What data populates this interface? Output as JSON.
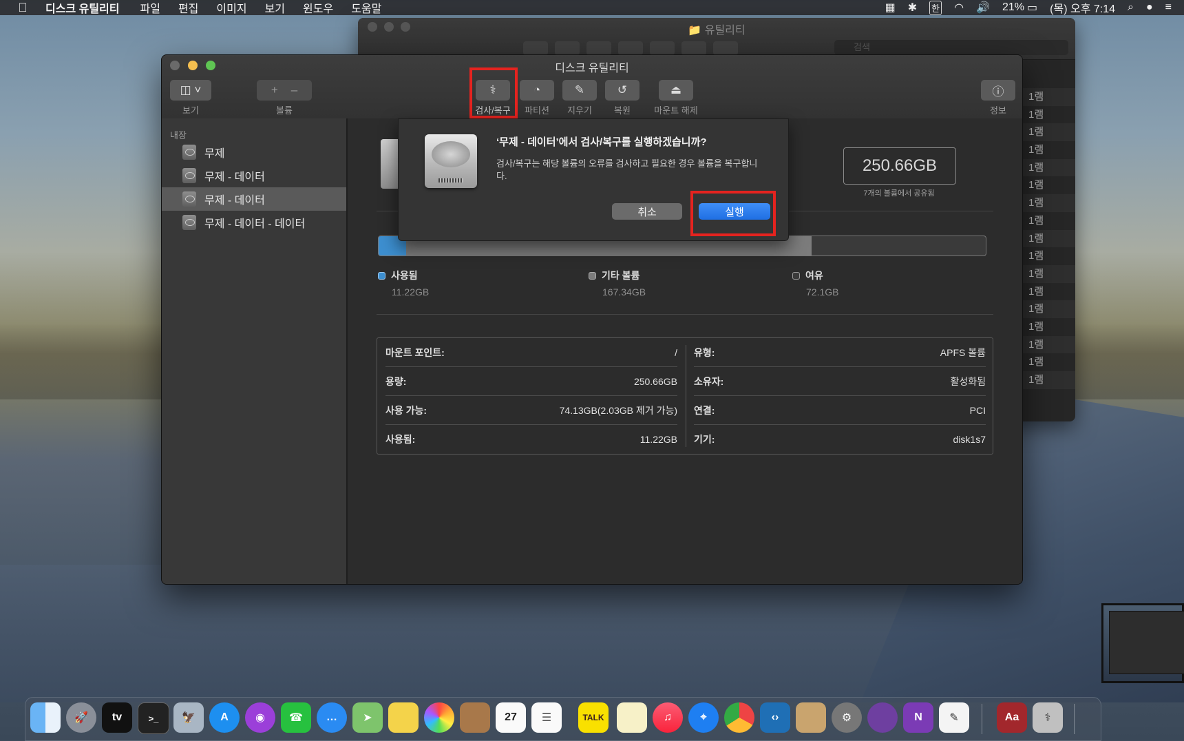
{
  "menubar": {
    "app": "디스크 유틸리티",
    "items": [
      "파일",
      "편집",
      "이미지",
      "보기",
      "윈도우",
      "도움말"
    ],
    "battery": "21%",
    "clock": "(목) 오후 7:14",
    "ime": "한"
  },
  "finder": {
    "title": "유틸리티",
    "search_placeholder": "검색",
    "column_values": [
      "1램",
      "1램",
      "1램",
      "1램",
      "1램",
      "1램",
      "1램",
      "1램",
      "1램",
      "1램",
      "1램",
      "1램",
      "1램",
      "1램",
      "1램",
      "1램",
      "1램"
    ]
  },
  "window": {
    "title": "디스크 유틸리티",
    "toolbar": {
      "view": "보기",
      "volume": "볼륨",
      "firstaid": "검사/복구",
      "partition": "파티션",
      "erase": "지우기",
      "restore": "복원",
      "unmount": "마운트 해제",
      "info": "정보"
    },
    "sidebar": {
      "header": "내장",
      "items": [
        "무제",
        "무제 - 데이터",
        "무제 - 데이터",
        "무제 - 데이터 - 데이터"
      ]
    }
  },
  "volume": {
    "capacity": "250.66GB",
    "shared": "7개의 볼륨에서 공유됨",
    "legend": {
      "used_label": "사용됨",
      "used_value": "11.22GB",
      "other_label": "기타 볼륨",
      "other_value": "167.34GB",
      "free_label": "여유",
      "free_value": "72.1GB"
    },
    "usage_fraction": {
      "used": 0.0448,
      "other": 0.6676
    },
    "info_left": [
      {
        "k": "마운트 포인트:",
        "v": "/"
      },
      {
        "k": "용량:",
        "v": "250.66GB"
      },
      {
        "k": "사용 가능:",
        "v": "74.13GB(2.03GB 제거 가능)"
      },
      {
        "k": "사용됨:",
        "v": "11.22GB"
      }
    ],
    "info_right": [
      {
        "k": "유형:",
        "v": "APFS 볼륨"
      },
      {
        "k": "소유자:",
        "v": "활성화됨"
      },
      {
        "k": "연결:",
        "v": "PCI"
      },
      {
        "k": "기기:",
        "v": "disk1s7"
      }
    ]
  },
  "dialog": {
    "question": "‘무제 - 데이터’에서 검사/복구를 실행하겠습니까?",
    "description": "검사/복구는 해당 볼륨의 오류를 검사하고 필요한 경우 볼륨을 복구합니다.",
    "cancel": "취소",
    "run": "실행"
  },
  "dock": {
    "tv_label": "tv",
    "calendar_day": "27",
    "kakao": "TALK",
    "dictionary": "Aa"
  }
}
